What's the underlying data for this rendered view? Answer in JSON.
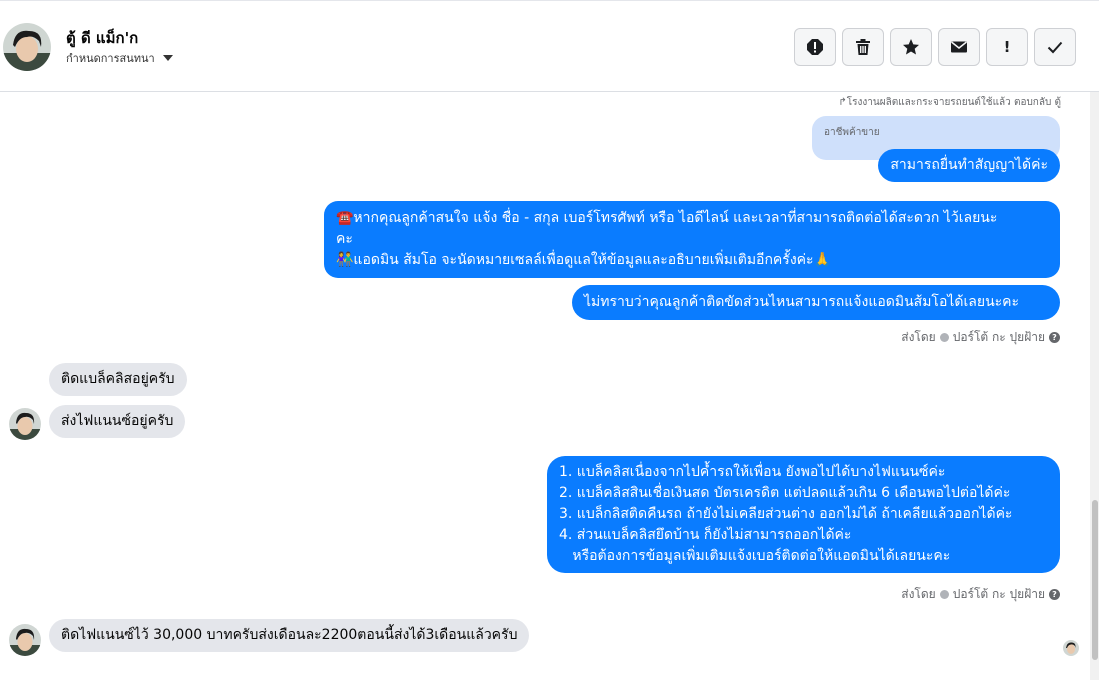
{
  "header": {
    "contact_name": "ตู้ ดี แม็ก'ก",
    "subtitle": "กำหนดการสนทนา",
    "toolbar": [
      {
        "name": "spam-icon",
        "label": ""
      },
      {
        "name": "trash-icon",
        "label": ""
      },
      {
        "name": "star-icon",
        "label": ""
      },
      {
        "name": "mail-icon",
        "label": ""
      },
      {
        "name": "follow-up-icon",
        "label": "!"
      },
      {
        "name": "check-icon",
        "label": ""
      }
    ]
  },
  "messages": {
    "reply_note": "โรงงานผลิตและกระจายรถยนต์ใช้แล้ว ตอบกลับ ตู้",
    "quote_text": "อาชีพค้าขาย",
    "out1": "สามารถยื่นทำสัญญาได้ค่ะ",
    "out2_lines": [
      "☎️หากคุณลูกค้าสนใจ แจ้ง ชื่อ - สกุล เบอร์โทรศัพท์ หรือ ไอดีไลน์ และเวลาที่สามารถติดต่อได้สะดวก ไว้เลยนะ",
      "คะ",
      "👫แอดมิน ส้มโอ จะนัดหมายเซลล์เพื่อดูแลให้ข้อมูลและอธิบายเพิ่มเติมอีกครั้งค่ะ🙏"
    ],
    "out3": "ไม่ทราบว่าคุณลูกค้าติดขัดส่วนไหนสามารถแจ้งแอดมินส้มโอได้เลยนะคะ",
    "sent_by_1": {
      "prefix": "ส่งโดย",
      "agent": "ปอร์โต้ กะ ปุยฝ้าย",
      "help": "?"
    },
    "in1": "ติดแบล็คลิสอยู่ครับ",
    "in2": "ส่งไฟแนนซ์อยู่ครับ",
    "out4_lines": [
      "1. แบล็คลิสเนื่องจากไปค้ำรถให้เพื่อน ยังพอไปได้บางไฟแนนซ์ค่ะ",
      "2. แบล็คลิสสินเชื่อเงินสด บัตรเครดิต แต่ปลดแล้วเกิน 6 เดือนพอไปต่อได้ค่ะ",
      "3. แบล็กลิสติดคืนรถ ถ้ายังไม่เคลียส่วนต่าง ออกไม่ได้ ถ้าเคลียแล้วออกได้ค่ะ",
      "4. ส่วนแบล็คลิสยึดบ้าน ก็ยังไม่สามารถออกได้ค่ะ",
      "   หรือต้องการข้อมูลเพิ่มเติมแจ้งเบอร์ติดต่อให้แอดมินได้เลยนะคะ"
    ],
    "sent_by_2": {
      "prefix": "ส่งโดย",
      "agent": "ปอร์โต้ กะ ปุยฝ้าย",
      "help": "?"
    },
    "in3": "ติดไฟแนนซ์ไว้ 30,000 บาทครับส่งเดือนละ2200ตอนนี้ส่งได้3เดือนแล้วครับ"
  },
  "colors": {
    "outgoing_bubble": "#0a7cff",
    "incoming_bubble": "#e4e6eb",
    "quote_bubble": "#cfe0fb"
  }
}
